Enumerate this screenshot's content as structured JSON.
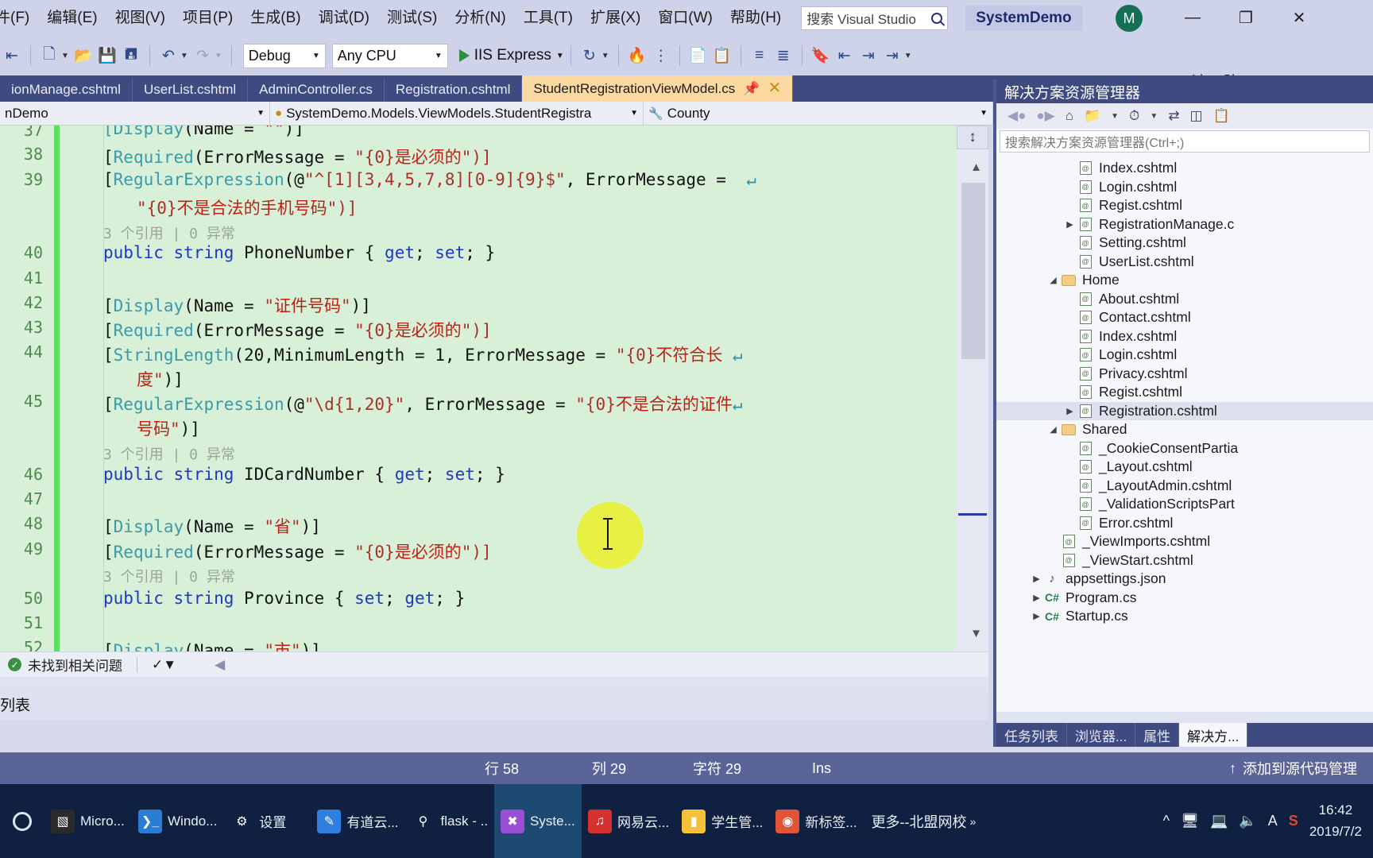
{
  "menubar": {
    "items": [
      "件(F)",
      "编辑(E)",
      "视图(V)",
      "项目(P)",
      "生成(B)",
      "调试(D)",
      "测试(S)",
      "分析(N)",
      "工具(T)",
      "扩展(X)",
      "窗口(W)",
      "帮助(H)"
    ],
    "search_placeholder": "搜索 Visual Studio",
    "project_name": "SystemDemo",
    "avatar_initial": "M",
    "window_minimize": "—",
    "window_maximize": "❐",
    "window_close": "✕",
    "live_share": "Live Share"
  },
  "toolbar": {
    "config": "Debug",
    "platform": "Any CPU",
    "run_target": "IIS Express"
  },
  "tabs": [
    {
      "label": "ionManage.cshtml",
      "active": false
    },
    {
      "label": "UserList.cshtml",
      "active": false
    },
    {
      "label": "AdminController.cs",
      "active": false
    },
    {
      "label": "Registration.cshtml",
      "active": false
    },
    {
      "label": "StudentRegistrationViewModel.cs",
      "active": true
    }
  ],
  "navbar": {
    "type_scope": "nDemo",
    "namespace": "SystemDemo.Models.ViewModels.StudentRegistra",
    "member": "County"
  },
  "editor": {
    "lines": [
      {
        "num": "37",
        "partial": true
      },
      {
        "num": "38"
      },
      {
        "num": "39"
      },
      {
        "num": "40"
      },
      {
        "num": "41"
      },
      {
        "num": "42"
      },
      {
        "num": "43"
      },
      {
        "num": "44"
      },
      {
        "num": "45"
      },
      {
        "num": "46"
      },
      {
        "num": "47"
      },
      {
        "num": "48"
      },
      {
        "num": "49"
      },
      {
        "num": "50"
      },
      {
        "num": "51"
      },
      {
        "num": "52"
      }
    ],
    "code": {
      "l37": "[Display(Name = \"手机号码\")]",
      "l37_attr": "Display",
      "l37_str": "手机号码",
      "l38_attr": "Required",
      "l38_mid": "(ErrorMessage = ",
      "l38_str_a": "\"{0}",
      "l38_str_cjk": "是必须的",
      "l38_end": "\")]",
      "l39_attr": "RegularExpression",
      "l39_mid": "(@",
      "l39_regex": "\"^[1][3,4,5,7,8][0-9]{9}$\"",
      "l39_tail": ", ErrorMessage = ",
      "l39b_str": "\"{0}",
      "l39b_cjk": "不是合法的手机号码",
      "l39b_end": "\")]",
      "refs_3": "3 个引用 | 0 异常",
      "l40": "public string PhoneNumber { get; set; }",
      "l40_prop": "PhoneNumber",
      "l42_attr": "Display",
      "l42_cjk": "证件号码",
      "l43_attr": "Required",
      "l44_attr": "StringLength",
      "l44_mid": "(20,MinimumLength = 1, ErrorMessage = ",
      "l44_cjk": "不符合长",
      "l44b_cjk": "度",
      "l45_attr": "RegularExpression",
      "l45_regex": "\"\\d{1,20}\"",
      "l45_tail": ", ErrorMessage = ",
      "l45_cjk": "不是合法的证件",
      "l45b_cjk": "号码",
      "l46_prop": "IDCardNumber",
      "l48_cjk": "省",
      "l50_prop": "Province",
      "l50_accessors": "{ set; get; }",
      "l52_cjk": "市"
    }
  },
  "solution_explorer": {
    "title": "解决方案资源管理器",
    "search_placeholder": "搜索解决方案资源管理器(Ctrl+;)",
    "toolbar_icons": [
      "back-arrow",
      "forward-arrow",
      "home",
      "new-folder",
      "history",
      "sync",
      "collapse-all",
      "properties"
    ],
    "tree": [
      {
        "label": "Index.cshtml",
        "indent": 4,
        "icon": "cshtml",
        "twisty": "",
        "selected": false
      },
      {
        "label": "Login.cshtml",
        "indent": 4,
        "icon": "cshtml",
        "twisty": "",
        "selected": false
      },
      {
        "label": "Regist.cshtml",
        "indent": 4,
        "icon": "cshtml",
        "twisty": "",
        "selected": false
      },
      {
        "label": "RegistrationManage.c",
        "indent": 4,
        "icon": "cshtml",
        "twisty": "▶",
        "selected": false
      },
      {
        "label": "Setting.cshtml",
        "indent": 4,
        "icon": "cshtml",
        "twisty": "",
        "selected": false
      },
      {
        "label": "UserList.cshtml",
        "indent": 4,
        "icon": "cshtml",
        "twisty": "",
        "selected": false
      },
      {
        "label": "Home",
        "indent": 3,
        "icon": "folder",
        "twisty": "◢",
        "selected": false
      },
      {
        "label": "About.cshtml",
        "indent": 4,
        "icon": "cshtml",
        "twisty": "",
        "selected": false
      },
      {
        "label": "Contact.cshtml",
        "indent": 4,
        "icon": "cshtml",
        "twisty": "",
        "selected": false
      },
      {
        "label": "Index.cshtml",
        "indent": 4,
        "icon": "cshtml",
        "twisty": "",
        "selected": false
      },
      {
        "label": "Login.cshtml",
        "indent": 4,
        "icon": "cshtml",
        "twisty": "",
        "selected": false
      },
      {
        "label": "Privacy.cshtml",
        "indent": 4,
        "icon": "cshtml",
        "twisty": "",
        "selected": false
      },
      {
        "label": "Regist.cshtml",
        "indent": 4,
        "icon": "cshtml",
        "twisty": "",
        "selected": false
      },
      {
        "label": "Registration.cshtml",
        "indent": 4,
        "icon": "cshtml",
        "twisty": "▶",
        "selected": true
      },
      {
        "label": "Shared",
        "indent": 3,
        "icon": "folder",
        "twisty": "◢",
        "selected": false
      },
      {
        "label": "_CookieConsentPartia",
        "indent": 4,
        "icon": "cshtml",
        "twisty": "",
        "selected": false
      },
      {
        "label": "_Layout.cshtml",
        "indent": 4,
        "icon": "cshtml",
        "twisty": "",
        "selected": false
      },
      {
        "label": "_LayoutAdmin.cshtml",
        "indent": 4,
        "icon": "cshtml",
        "twisty": "",
        "selected": false
      },
      {
        "label": "_ValidationScriptsPart",
        "indent": 4,
        "icon": "cshtml",
        "twisty": "",
        "selected": false
      },
      {
        "label": "Error.cshtml",
        "indent": 4,
        "icon": "cshtml",
        "twisty": "",
        "selected": false
      },
      {
        "label": "_ViewImports.cshtml",
        "indent": 3,
        "icon": "cshtml",
        "twisty": "",
        "selected": false
      },
      {
        "label": "_ViewStart.cshtml",
        "indent": 3,
        "icon": "cshtml",
        "twisty": "",
        "selected": false
      },
      {
        "label": "appsettings.json",
        "indent": 2,
        "icon": "json",
        "twisty": "▶",
        "selected": false
      },
      {
        "label": "Program.cs",
        "indent": 2,
        "icon": "cs",
        "twisty": "▶",
        "selected": false
      },
      {
        "label": "Startup.cs",
        "indent": 2,
        "icon": "cs",
        "twisty": "▶",
        "selected": false
      }
    ],
    "bottom_tabs": [
      {
        "label": "任务列表",
        "active": false
      },
      {
        "label": "浏览器...",
        "active": false
      },
      {
        "label": "属性",
        "active": false
      },
      {
        "label": "解决方...",
        "active": true
      }
    ]
  },
  "error_strip": {
    "message": "未找到相关问题"
  },
  "left_lower_panel": {
    "label": "列表"
  },
  "statusbar": {
    "row": "行 58",
    "col": "列 29",
    "chars": "字符 29",
    "insert_mode": "Ins",
    "source_control": "添加到源代码管理"
  },
  "taskbar": {
    "buttons": [
      {
        "label": "Micro...",
        "glyph": "▧",
        "color": "#2a2a2a",
        "active": false
      },
      {
        "label": "Windo...",
        "glyph": "❯_",
        "color": "#2b7cd3",
        "active": false
      },
      {
        "label": "设置",
        "glyph": "⚙",
        "color": "#102040",
        "active": false
      },
      {
        "label": "有道云...",
        "glyph": "✎",
        "color": "#2f7fe0",
        "active": false
      },
      {
        "label": "flask - ..",
        "glyph": "⚲",
        "color": "#102040",
        "active": false
      },
      {
        "label": "Syste...",
        "glyph": "✖",
        "color": "#9b4fd6",
        "active": true
      },
      {
        "label": "网易云...",
        "glyph": "♫",
        "color": "#d63031",
        "active": false
      },
      {
        "label": "学生管...",
        "glyph": "▮",
        "color": "#f3c13a",
        "active": false
      },
      {
        "label": "新标签...",
        "glyph": "◉",
        "color": "#e0543a",
        "active": false
      }
    ],
    "more_label": "更多--北盟网校",
    "tray_icons": [
      "chevron-up",
      "network",
      "display",
      "volume",
      "ime-A",
      "s-app"
    ],
    "clock_time": "16:42",
    "clock_date": "2019/7/2"
  }
}
